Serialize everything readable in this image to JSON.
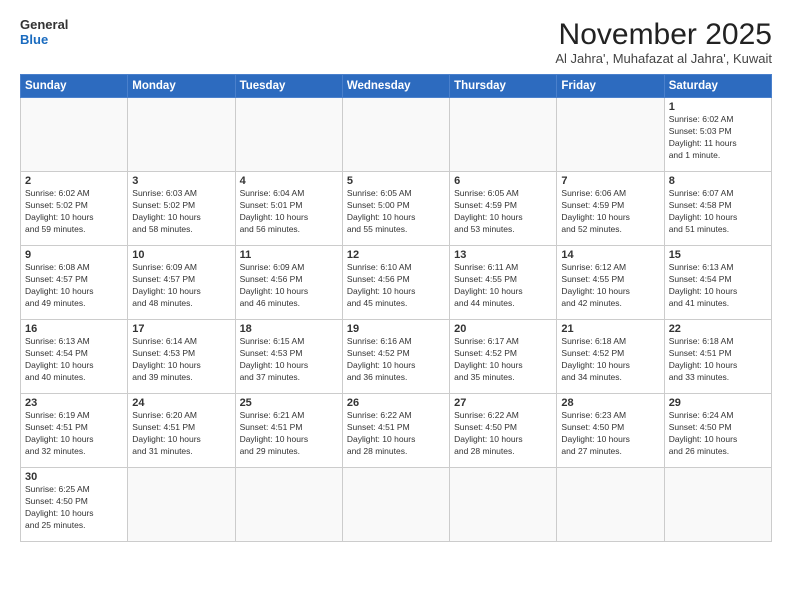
{
  "logo": {
    "line1": "General",
    "line2": "Blue"
  },
  "header": {
    "month": "November 2025",
    "location": "Al Jahra', Muhafazat al Jahra', Kuwait"
  },
  "weekdays": [
    "Sunday",
    "Monday",
    "Tuesday",
    "Wednesday",
    "Thursday",
    "Friday",
    "Saturday"
  ],
  "days": {
    "1": "Sunrise: 6:02 AM\nSunset: 5:03 PM\nDaylight: 11 hours\nand 1 minute.",
    "2": "Sunrise: 6:02 AM\nSunset: 5:02 PM\nDaylight: 10 hours\nand 59 minutes.",
    "3": "Sunrise: 6:03 AM\nSunset: 5:02 PM\nDaylight: 10 hours\nand 58 minutes.",
    "4": "Sunrise: 6:04 AM\nSunset: 5:01 PM\nDaylight: 10 hours\nand 56 minutes.",
    "5": "Sunrise: 6:05 AM\nSunset: 5:00 PM\nDaylight: 10 hours\nand 55 minutes.",
    "6": "Sunrise: 6:05 AM\nSunset: 4:59 PM\nDaylight: 10 hours\nand 53 minutes.",
    "7": "Sunrise: 6:06 AM\nSunset: 4:59 PM\nDaylight: 10 hours\nand 52 minutes.",
    "8": "Sunrise: 6:07 AM\nSunset: 4:58 PM\nDaylight: 10 hours\nand 51 minutes.",
    "9": "Sunrise: 6:08 AM\nSunset: 4:57 PM\nDaylight: 10 hours\nand 49 minutes.",
    "10": "Sunrise: 6:09 AM\nSunset: 4:57 PM\nDaylight: 10 hours\nand 48 minutes.",
    "11": "Sunrise: 6:09 AM\nSunset: 4:56 PM\nDaylight: 10 hours\nand 46 minutes.",
    "12": "Sunrise: 6:10 AM\nSunset: 4:56 PM\nDaylight: 10 hours\nand 45 minutes.",
    "13": "Sunrise: 6:11 AM\nSunset: 4:55 PM\nDaylight: 10 hours\nand 44 minutes.",
    "14": "Sunrise: 6:12 AM\nSunset: 4:55 PM\nDaylight: 10 hours\nand 42 minutes.",
    "15": "Sunrise: 6:13 AM\nSunset: 4:54 PM\nDaylight: 10 hours\nand 41 minutes.",
    "16": "Sunrise: 6:13 AM\nSunset: 4:54 PM\nDaylight: 10 hours\nand 40 minutes.",
    "17": "Sunrise: 6:14 AM\nSunset: 4:53 PM\nDaylight: 10 hours\nand 39 minutes.",
    "18": "Sunrise: 6:15 AM\nSunset: 4:53 PM\nDaylight: 10 hours\nand 37 minutes.",
    "19": "Sunrise: 6:16 AM\nSunset: 4:52 PM\nDaylight: 10 hours\nand 36 minutes.",
    "20": "Sunrise: 6:17 AM\nSunset: 4:52 PM\nDaylight: 10 hours\nand 35 minutes.",
    "21": "Sunrise: 6:18 AM\nSunset: 4:52 PM\nDaylight: 10 hours\nand 34 minutes.",
    "22": "Sunrise: 6:18 AM\nSunset: 4:51 PM\nDaylight: 10 hours\nand 33 minutes.",
    "23": "Sunrise: 6:19 AM\nSunset: 4:51 PM\nDaylight: 10 hours\nand 32 minutes.",
    "24": "Sunrise: 6:20 AM\nSunset: 4:51 PM\nDaylight: 10 hours\nand 31 minutes.",
    "25": "Sunrise: 6:21 AM\nSunset: 4:51 PM\nDaylight: 10 hours\nand 29 minutes.",
    "26": "Sunrise: 6:22 AM\nSunset: 4:51 PM\nDaylight: 10 hours\nand 28 minutes.",
    "27": "Sunrise: 6:22 AM\nSunset: 4:50 PM\nDaylight: 10 hours\nand 28 minutes.",
    "28": "Sunrise: 6:23 AM\nSunset: 4:50 PM\nDaylight: 10 hours\nand 27 minutes.",
    "29": "Sunrise: 6:24 AM\nSunset: 4:50 PM\nDaylight: 10 hours\nand 26 minutes.",
    "30": "Sunrise: 6:25 AM\nSunset: 4:50 PM\nDaylight: 10 hours\nand 25 minutes."
  }
}
